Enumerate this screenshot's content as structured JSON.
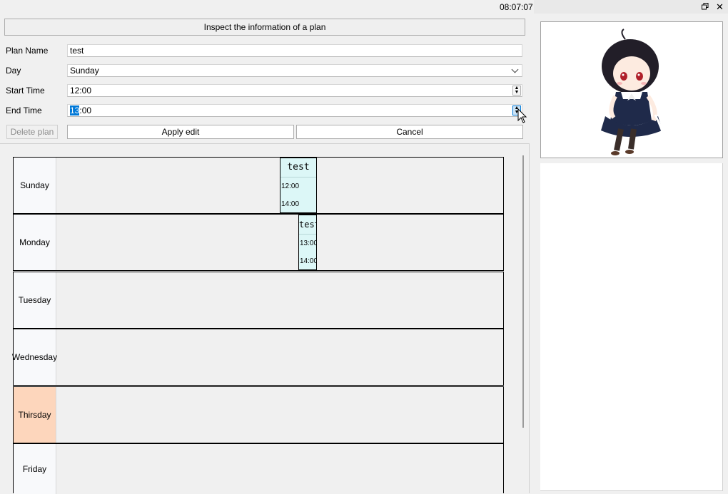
{
  "clock": "08:07:07",
  "header": {
    "title": "Inspect the information of a plan"
  },
  "form": {
    "plan_name_label": "Plan Name",
    "plan_name_value": "test",
    "day_label": "Day",
    "day_value": "Sunday",
    "start_label": "Start Time",
    "start_value": "12:00",
    "end_label": "End Time",
    "end_value_selected": "13",
    "end_value_rest": ":00"
  },
  "buttons": {
    "delete": "Delete plan",
    "apply": "Apply edit",
    "cancel": "Cancel"
  },
  "schedule": {
    "days": [
      "Sunday",
      "Monday",
      "Tuesday",
      "Wednesday",
      "Thirsday",
      "Friday"
    ],
    "highlighted_day": "Thirsday",
    "events": [
      {
        "day": "Sunday",
        "name": "test",
        "start": "12:00",
        "end": "14:00"
      },
      {
        "day": "Monday",
        "name": "test",
        "start": "13:00",
        "end": "14:00"
      }
    ]
  },
  "colors": {
    "event_bg": "#dcf7f7",
    "highlight_day_bg": "#fdd6bc",
    "selection": "#0078d7"
  },
  "icons": [
    "restore-window-icon",
    "close-icon",
    "spin-up-icon",
    "spin-down-icon",
    "chevron-down-icon",
    "mouse-cursor-icon"
  ]
}
